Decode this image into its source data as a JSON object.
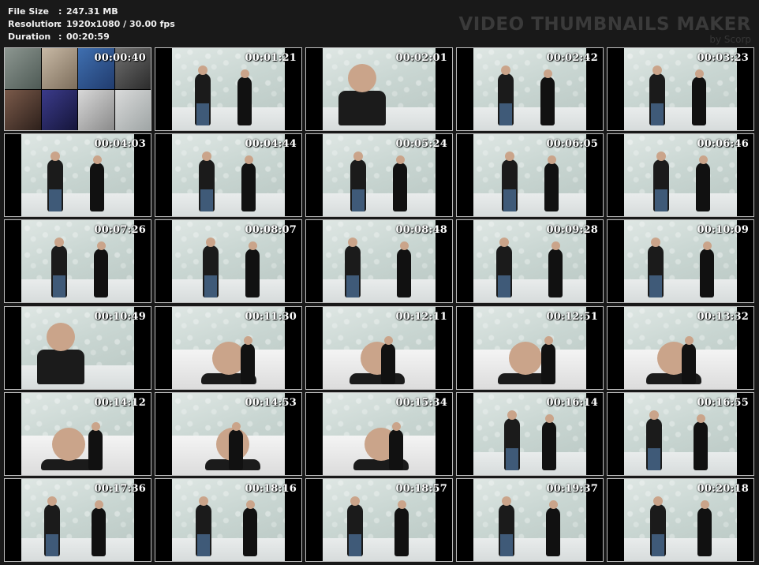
{
  "info": {
    "file_size_label": "File Size",
    "file_size_value": "247.31 MB",
    "resolution_label": "Resolution",
    "resolution_value": "1920x1080 / 30.00 fps",
    "duration_label": "Duration",
    "duration_value": "00:20:59",
    "separator": ":"
  },
  "brand": {
    "title": "VIDEO THUMBNAILS MAKER",
    "subtitle": "by Scorp"
  },
  "thumbnails": [
    {
      "time": "00:00:40",
      "scene": "mosaic"
    },
    {
      "time": "00:01:21",
      "scene": "wall"
    },
    {
      "time": "00:02:01",
      "scene": "closeup"
    },
    {
      "time": "00:02:42",
      "scene": "wall"
    },
    {
      "time": "00:03:23",
      "scene": "wall"
    },
    {
      "time": "00:04:03",
      "scene": "wall"
    },
    {
      "time": "00:04:44",
      "scene": "wall"
    },
    {
      "time": "00:05:24",
      "scene": "wall"
    },
    {
      "time": "00:06:05",
      "scene": "wall"
    },
    {
      "time": "00:06:46",
      "scene": "wall"
    },
    {
      "time": "00:07:26",
      "scene": "wall"
    },
    {
      "time": "00:08:07",
      "scene": "wall"
    },
    {
      "time": "00:08:48",
      "scene": "wall"
    },
    {
      "time": "00:09:28",
      "scene": "wall"
    },
    {
      "time": "00:10:09",
      "scene": "wall"
    },
    {
      "time": "00:10:49",
      "scene": "closeup"
    },
    {
      "time": "00:11:30",
      "scene": "bed"
    },
    {
      "time": "00:12:11",
      "scene": "bed"
    },
    {
      "time": "00:12:51",
      "scene": "bed"
    },
    {
      "time": "00:13:32",
      "scene": "bed"
    },
    {
      "time": "00:14:12",
      "scene": "bed"
    },
    {
      "time": "00:14:53",
      "scene": "bed"
    },
    {
      "time": "00:15:34",
      "scene": "bed"
    },
    {
      "time": "00:16:14",
      "scene": "wall"
    },
    {
      "time": "00:16:55",
      "scene": "wall"
    },
    {
      "time": "00:17:36",
      "scene": "wall"
    },
    {
      "time": "00:18:16",
      "scene": "room"
    },
    {
      "time": "00:18:57",
      "scene": "room"
    },
    {
      "time": "00:19:37",
      "scene": "wall"
    },
    {
      "time": "00:20:18",
      "scene": "room"
    }
  ]
}
